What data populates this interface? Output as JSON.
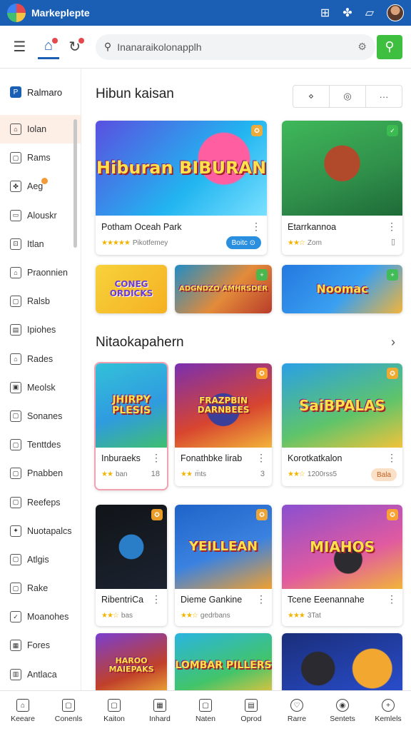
{
  "app": {
    "title": "Markeplepte"
  },
  "search": {
    "value": "Inanaraikolonapplh"
  },
  "sidebar": {
    "header": "Ralmaro",
    "items": [
      {
        "label": "Iolan",
        "icon": "tag-icon"
      },
      {
        "label": "Rams",
        "icon": "bookmark-icon"
      },
      {
        "label": "Aeg",
        "icon": "puzzle-icon"
      },
      {
        "label": "Alouskr",
        "icon": "monitor-icon"
      },
      {
        "label": "Itlan",
        "icon": "car-icon"
      },
      {
        "label": "Praonnien",
        "icon": "home-icon"
      },
      {
        "label": "Ralsb",
        "icon": "tablet-icon"
      },
      {
        "label": "Ipiohes",
        "icon": "document-icon"
      },
      {
        "label": "Rades",
        "icon": "building-icon"
      },
      {
        "label": "Meolsk",
        "icon": "image-icon"
      },
      {
        "label": "Sonanes",
        "icon": "bookmark-icon"
      },
      {
        "label": "Tenttdes",
        "icon": "lock-icon"
      },
      {
        "label": "Pnabben",
        "icon": "calendar-icon"
      },
      {
        "label": "Reefeps",
        "icon": "folder-icon"
      },
      {
        "label": "Nuotapalcs",
        "icon": "star-icon"
      },
      {
        "label": "Atlgis",
        "icon": "chart-icon"
      },
      {
        "label": "Rake",
        "icon": "user-icon"
      },
      {
        "label": "Moanohes",
        "icon": "checklist-icon"
      },
      {
        "label": "Fores",
        "icon": "grid-icon"
      },
      {
        "label": "Antlaca",
        "icon": "book-icon"
      }
    ]
  },
  "featured": {
    "title": "Hibun kaisan",
    "seg": [
      "⋄",
      "◎",
      "···"
    ],
    "cards": [
      {
        "art": "Hiburan BIBURAN",
        "name": "Potham Oceah Park",
        "rating": "★★★★★",
        "sub": "Pikotfemey",
        "pill": "Boitc ⊙"
      },
      {
        "art": "",
        "name": "Etarrkannoa",
        "rating": "★★☆",
        "sub": "Zom",
        "pill": ""
      }
    ],
    "small": [
      "CONEG ORDICKS",
      "ADGNDZO AMHRSDER",
      "Noomac"
    ]
  },
  "section2": {
    "title": "Nitaokapahern",
    "cards": [
      {
        "art": "JHIRPY PLESIS",
        "name": "Inburaeks",
        "rating": "★★",
        "sub": "ban",
        "extra": "18"
      },
      {
        "art": "FRAZPBIN DARNBEES",
        "name": "Fonathbke lirab",
        "rating": "★★",
        "sub": "m̈ts",
        "extra": "3"
      },
      {
        "art": "SaiBPALAS",
        "name": "Korotkatkalon",
        "rating": "★★☆",
        "sub": "1200rss5",
        "extra": "Bala"
      },
      {
        "art": "",
        "name": "RibentriCa",
        "rating": "★★☆",
        "sub": "bas",
        "extra": ""
      },
      {
        "art": "YEILLEAN",
        "name": "Dieme Gankine",
        "rating": "★★☆",
        "sub": "gedrbans",
        "extra": ""
      },
      {
        "art": "MIAHOS",
        "name": "Tcene Eeenannahe",
        "rating": "★★★",
        "sub": "3Tat",
        "extra": ""
      },
      {
        "art": "HAROO MAIEPAKS",
        "name": "",
        "rating": "",
        "sub": "",
        "extra": ""
      },
      {
        "art": "LOMBAR PILLERS",
        "name": "",
        "rating": "",
        "sub": "",
        "extra": ""
      },
      {
        "art": "",
        "name": "",
        "rating": "",
        "sub": "",
        "extra": ""
      }
    ]
  },
  "bottom_nav": [
    {
      "label": "Keeare",
      "icon": "home-icon"
    },
    {
      "label": "Conenls",
      "icon": "store-icon"
    },
    {
      "label": "Kaiton",
      "icon": "bag-icon"
    },
    {
      "label": "Inhard",
      "icon": "grid-icon"
    },
    {
      "label": "Naten",
      "icon": "controller-icon"
    },
    {
      "label": "Oprod",
      "icon": "book-icon"
    },
    {
      "label": "Rarre",
      "icon": "heart-icon"
    },
    {
      "label": "Sentets",
      "icon": "user-icon"
    },
    {
      "label": "Kemlels",
      "icon": "plus-icon"
    }
  ]
}
